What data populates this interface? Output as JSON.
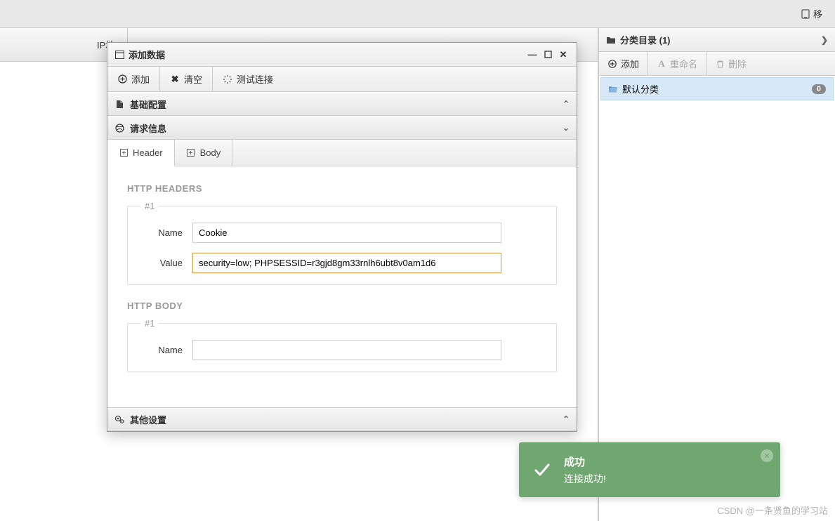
{
  "top_bar": {
    "mobile_label": "移"
  },
  "main": {
    "col_header": "IP地"
  },
  "right_panel": {
    "title": "分类目录 (1)",
    "add_label": "添加",
    "rename_label": "重命名",
    "delete_label": "删除",
    "category": {
      "name": "默认分类",
      "count": "0"
    }
  },
  "dialog": {
    "title": "添加数据",
    "toolbar": {
      "add": "添加",
      "clear": "清空",
      "test": "测试连接"
    },
    "sections": {
      "basic": "基础配置",
      "request": "请求信息",
      "other": "其他设置"
    },
    "tabs": {
      "header": "Header",
      "body": "Body"
    },
    "headers_section_title": "HTTP HEADERS",
    "body_section_title": "HTTP BODY",
    "group_label": "#1",
    "labels": {
      "name": "Name",
      "value": "Value"
    },
    "header_row": {
      "name": "Cookie",
      "value": "security=low; PHPSESSID=r3gjd8gm33rnlh6ubt8v0am1d6"
    },
    "body_row": {
      "name": ""
    }
  },
  "toast": {
    "title": "成功",
    "message": "连接成功!"
  },
  "watermark": "CSDN @一条贤鱼的学习站"
}
